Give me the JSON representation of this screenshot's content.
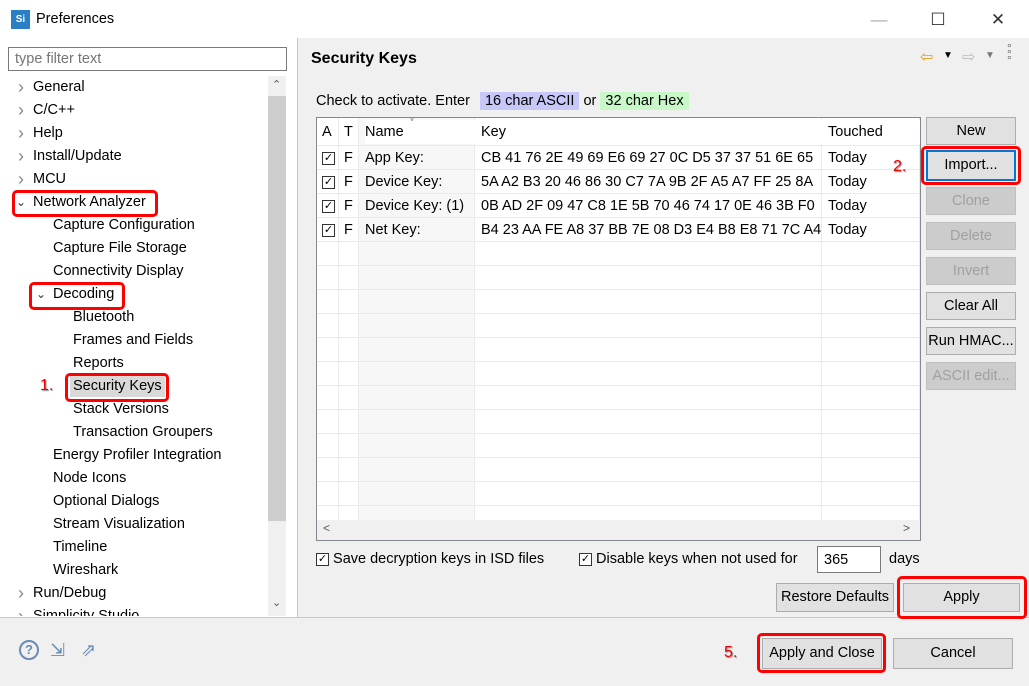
{
  "window": {
    "title": "Preferences",
    "logo": "Si",
    "minimize": "—",
    "maximize": "☐",
    "close": "✕"
  },
  "filter": {
    "placeholder": "type filter text"
  },
  "tree": [
    {
      "label": "General",
      "level": 0,
      "chev": ">"
    },
    {
      "label": "C/C++",
      "level": 0,
      "chev": ">"
    },
    {
      "label": "Help",
      "level": 0,
      "chev": ">"
    },
    {
      "label": "Install/Update",
      "level": 0,
      "chev": ">"
    },
    {
      "label": "MCU",
      "level": 0,
      "chev": ">"
    },
    {
      "label": "Network Analyzer",
      "level": 0,
      "chev": "v"
    },
    {
      "label": "Capture Configuration",
      "level": 1
    },
    {
      "label": "Capture File Storage",
      "level": 1
    },
    {
      "label": "Connectivity Display",
      "level": 1
    },
    {
      "label": "Decoding",
      "level": 1,
      "chev": "v"
    },
    {
      "label": "Bluetooth",
      "level": 2
    },
    {
      "label": "Frames and Fields",
      "level": 2
    },
    {
      "label": "Reports",
      "level": 2
    },
    {
      "label": "Security Keys",
      "level": 2,
      "selected": true
    },
    {
      "label": "Stack Versions",
      "level": 2
    },
    {
      "label": "Transaction Groupers",
      "level": 2
    },
    {
      "label": "Energy Profiler Integration",
      "level": 1
    },
    {
      "label": "Node Icons",
      "level": 1
    },
    {
      "label": "Optional Dialogs",
      "level": 1
    },
    {
      "label": "Stream Visualization",
      "level": 1
    },
    {
      "label": "Timeline",
      "level": 1
    },
    {
      "label": "Wireshark",
      "level": 1
    },
    {
      "label": "Run/Debug",
      "level": 0,
      "chev": ">"
    },
    {
      "label": "Simplicity Studio",
      "level": 0,
      "chev": ">"
    }
  ],
  "page": {
    "title": "Security Keys",
    "hint": "Check to activate. Enter",
    "ascii": "16 char ASCII",
    "or": "or",
    "hex": "32 char Hex",
    "ascii_color": "#c8c8f8",
    "hex_color": "#c8f8c8"
  },
  "table": {
    "columns": [
      "A",
      "T",
      "Name",
      "Key",
      "Touched"
    ],
    "rows": [
      {
        "checked": true,
        "t": "F",
        "name": "App Key:",
        "key": "CB 41 76 2E 49 69 E6 69 27 0C D5 37 37 51 6E 65",
        "touched": "Today"
      },
      {
        "checked": true,
        "t": "F",
        "name": "Device Key:",
        "key": "5A A2 B3 20 46 86 30 C7 7A 9B 2F A5 A7 FF 25 8A",
        "touched": "Today"
      },
      {
        "checked": true,
        "t": "F",
        "name": "Device Key: (1)",
        "key": "0B AD 2F 09 47 C8 1E 5B 70 46 74 17 0E 46 3B F0",
        "touched": "Today"
      },
      {
        "checked": true,
        "t": "F",
        "name": "Net Key:",
        "key": "B4 23 AA FE A8 37 BB 7E 08 D3 E4 B8 E8 71 7C A4",
        "touched": "Today"
      }
    ]
  },
  "side_buttons": [
    {
      "label": "New",
      "enabled": true
    },
    {
      "label": "Import...",
      "enabled": true,
      "focused": true
    },
    {
      "label": "Clone",
      "enabled": false
    },
    {
      "label": "Delete",
      "enabled": false
    },
    {
      "label": "Invert",
      "enabled": false
    },
    {
      "label": "Clear All",
      "enabled": true
    },
    {
      "label": "Run HMAC...",
      "enabled": true
    },
    {
      "label": "ASCII edit...",
      "enabled": false
    }
  ],
  "options": {
    "save_keys": "Save decryption keys in ISD files",
    "save_checked": true,
    "disable_keys": "Disable keys when not used for",
    "disable_checked": true,
    "days_value": "365",
    "days_label": "days"
  },
  "buttons": {
    "restore": "Restore Defaults",
    "apply": "Apply",
    "apply_close": "Apply and Close",
    "cancel": "Cancel"
  },
  "annotations": {
    "step1": "1.",
    "step2": "2.",
    "step5": "5.",
    "color": "#ff0000"
  }
}
